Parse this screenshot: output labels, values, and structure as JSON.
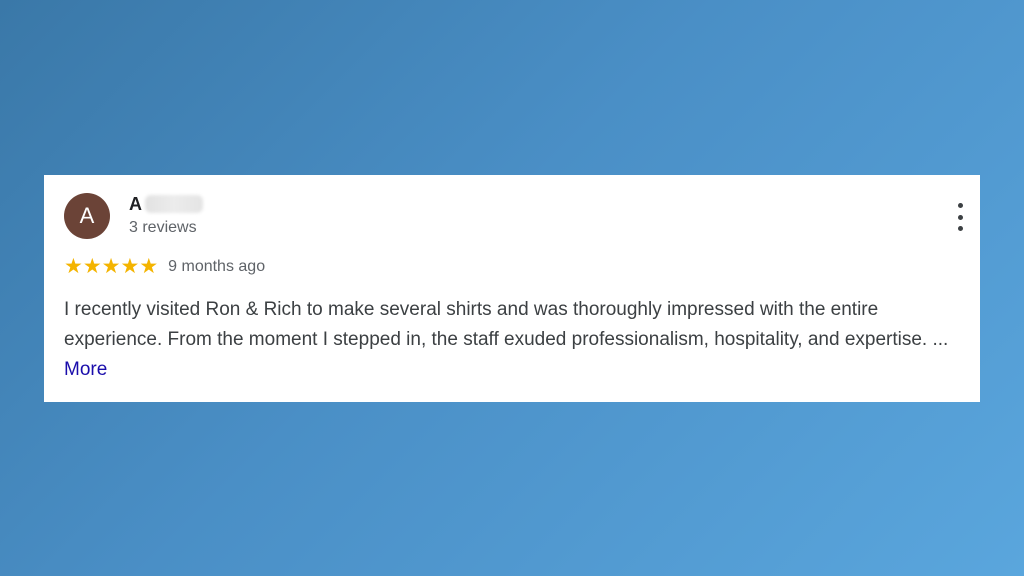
{
  "review": {
    "author_initial": "A",
    "author_name_visible": "A",
    "review_count": "3 reviews",
    "rating": 5,
    "rating_max": 5,
    "date": "9 months ago",
    "text": "I recently visited Ron & Rich to make several shirts and was thoroughly impressed with the entire experience. From the moment I stepped in, the staff exuded professionalism, hospitality, and expertise. ...",
    "more_label": "More"
  },
  "icons": {
    "star": "star-icon",
    "more_options": "more-vert-icon"
  },
  "colors": {
    "avatar_bg": "#6b4337",
    "star": "#f4b400",
    "link": "#1a0dab",
    "background_start": "#3a78a8",
    "background_end": "#5aa6dd"
  }
}
